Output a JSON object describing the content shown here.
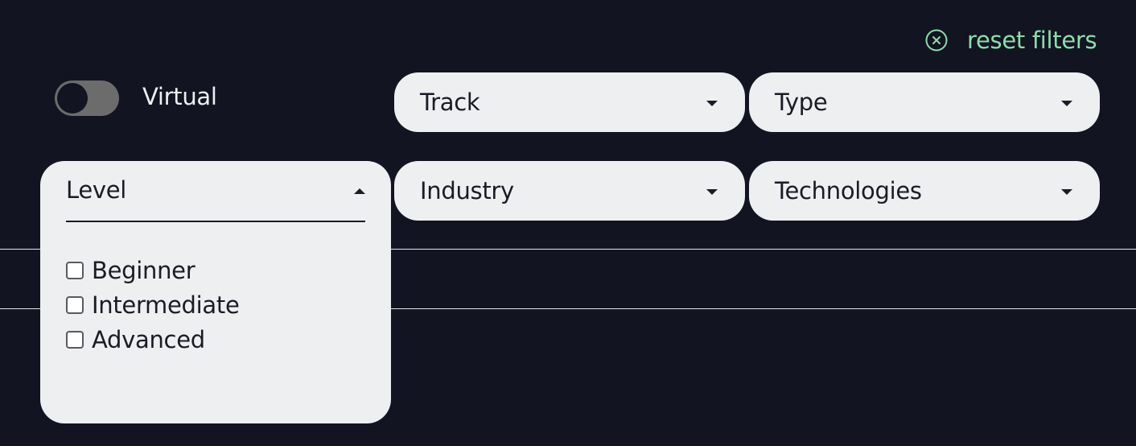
{
  "reset": {
    "icon": "close-circle-icon",
    "label": "reset filters",
    "color": "#8fdcab"
  },
  "virtual_toggle": {
    "label": "Virtual",
    "on": false
  },
  "filters": {
    "track": {
      "label": "Track",
      "icon": "caret-down-icon"
    },
    "type": {
      "label": "Type",
      "icon": "caret-down-icon"
    },
    "industry": {
      "label": "Industry",
      "icon": "caret-down-icon"
    },
    "technologies": {
      "label": "Technologies",
      "icon": "caret-down-icon"
    },
    "level": {
      "label": "Level",
      "icon": "caret-up-icon",
      "expanded": true,
      "options": [
        {
          "label": "Beginner",
          "checked": false
        },
        {
          "label": "Intermediate",
          "checked": false
        },
        {
          "label": "Advanced",
          "checked": false
        }
      ]
    }
  },
  "colors": {
    "background": "#121422",
    "control_background": "#eeeff1",
    "text_dark": "#1a1b26",
    "text_light": "#eeeff1",
    "toggle_track": "#6c6c6c"
  }
}
